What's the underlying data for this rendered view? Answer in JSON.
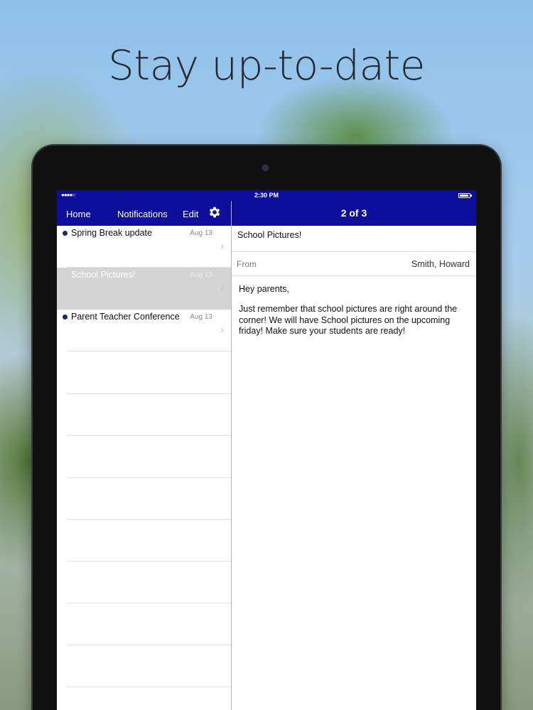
{
  "headline": "Stay up-to-date",
  "status_bar": {
    "time": "2:30 PM",
    "signal": "●●●●○"
  },
  "nav": {
    "home": "Home",
    "notifications": "Notifications",
    "edit": "Edit",
    "pager": "2 of 3"
  },
  "messages": [
    {
      "title": "Spring Break update",
      "date": "Aug 13",
      "unread": true,
      "selected": false
    },
    {
      "title": "School Pictures!",
      "date": "Aug 13",
      "unread": false,
      "selected": true
    },
    {
      "title": "Parent Teacher Conference",
      "date": "Aug 13",
      "unread": true,
      "selected": false
    }
  ],
  "detail": {
    "subject": "School Pictures!",
    "from_label": "From",
    "from_value": "Smith, Howard",
    "greeting": "Hey parents,",
    "body": "Just remember that school pictures are right around the corner! We will have School pictures on the upcoming friday! Make sure your students are ready!"
  },
  "colors": {
    "nav_bar": "#0b0f9b",
    "unread_dot": "#1a2a6b",
    "selected_row": "#d4d4d4"
  },
  "icons": {
    "settings": "gear-icon",
    "disclosure": "chevron-right-icon",
    "battery": "battery-icon"
  }
}
